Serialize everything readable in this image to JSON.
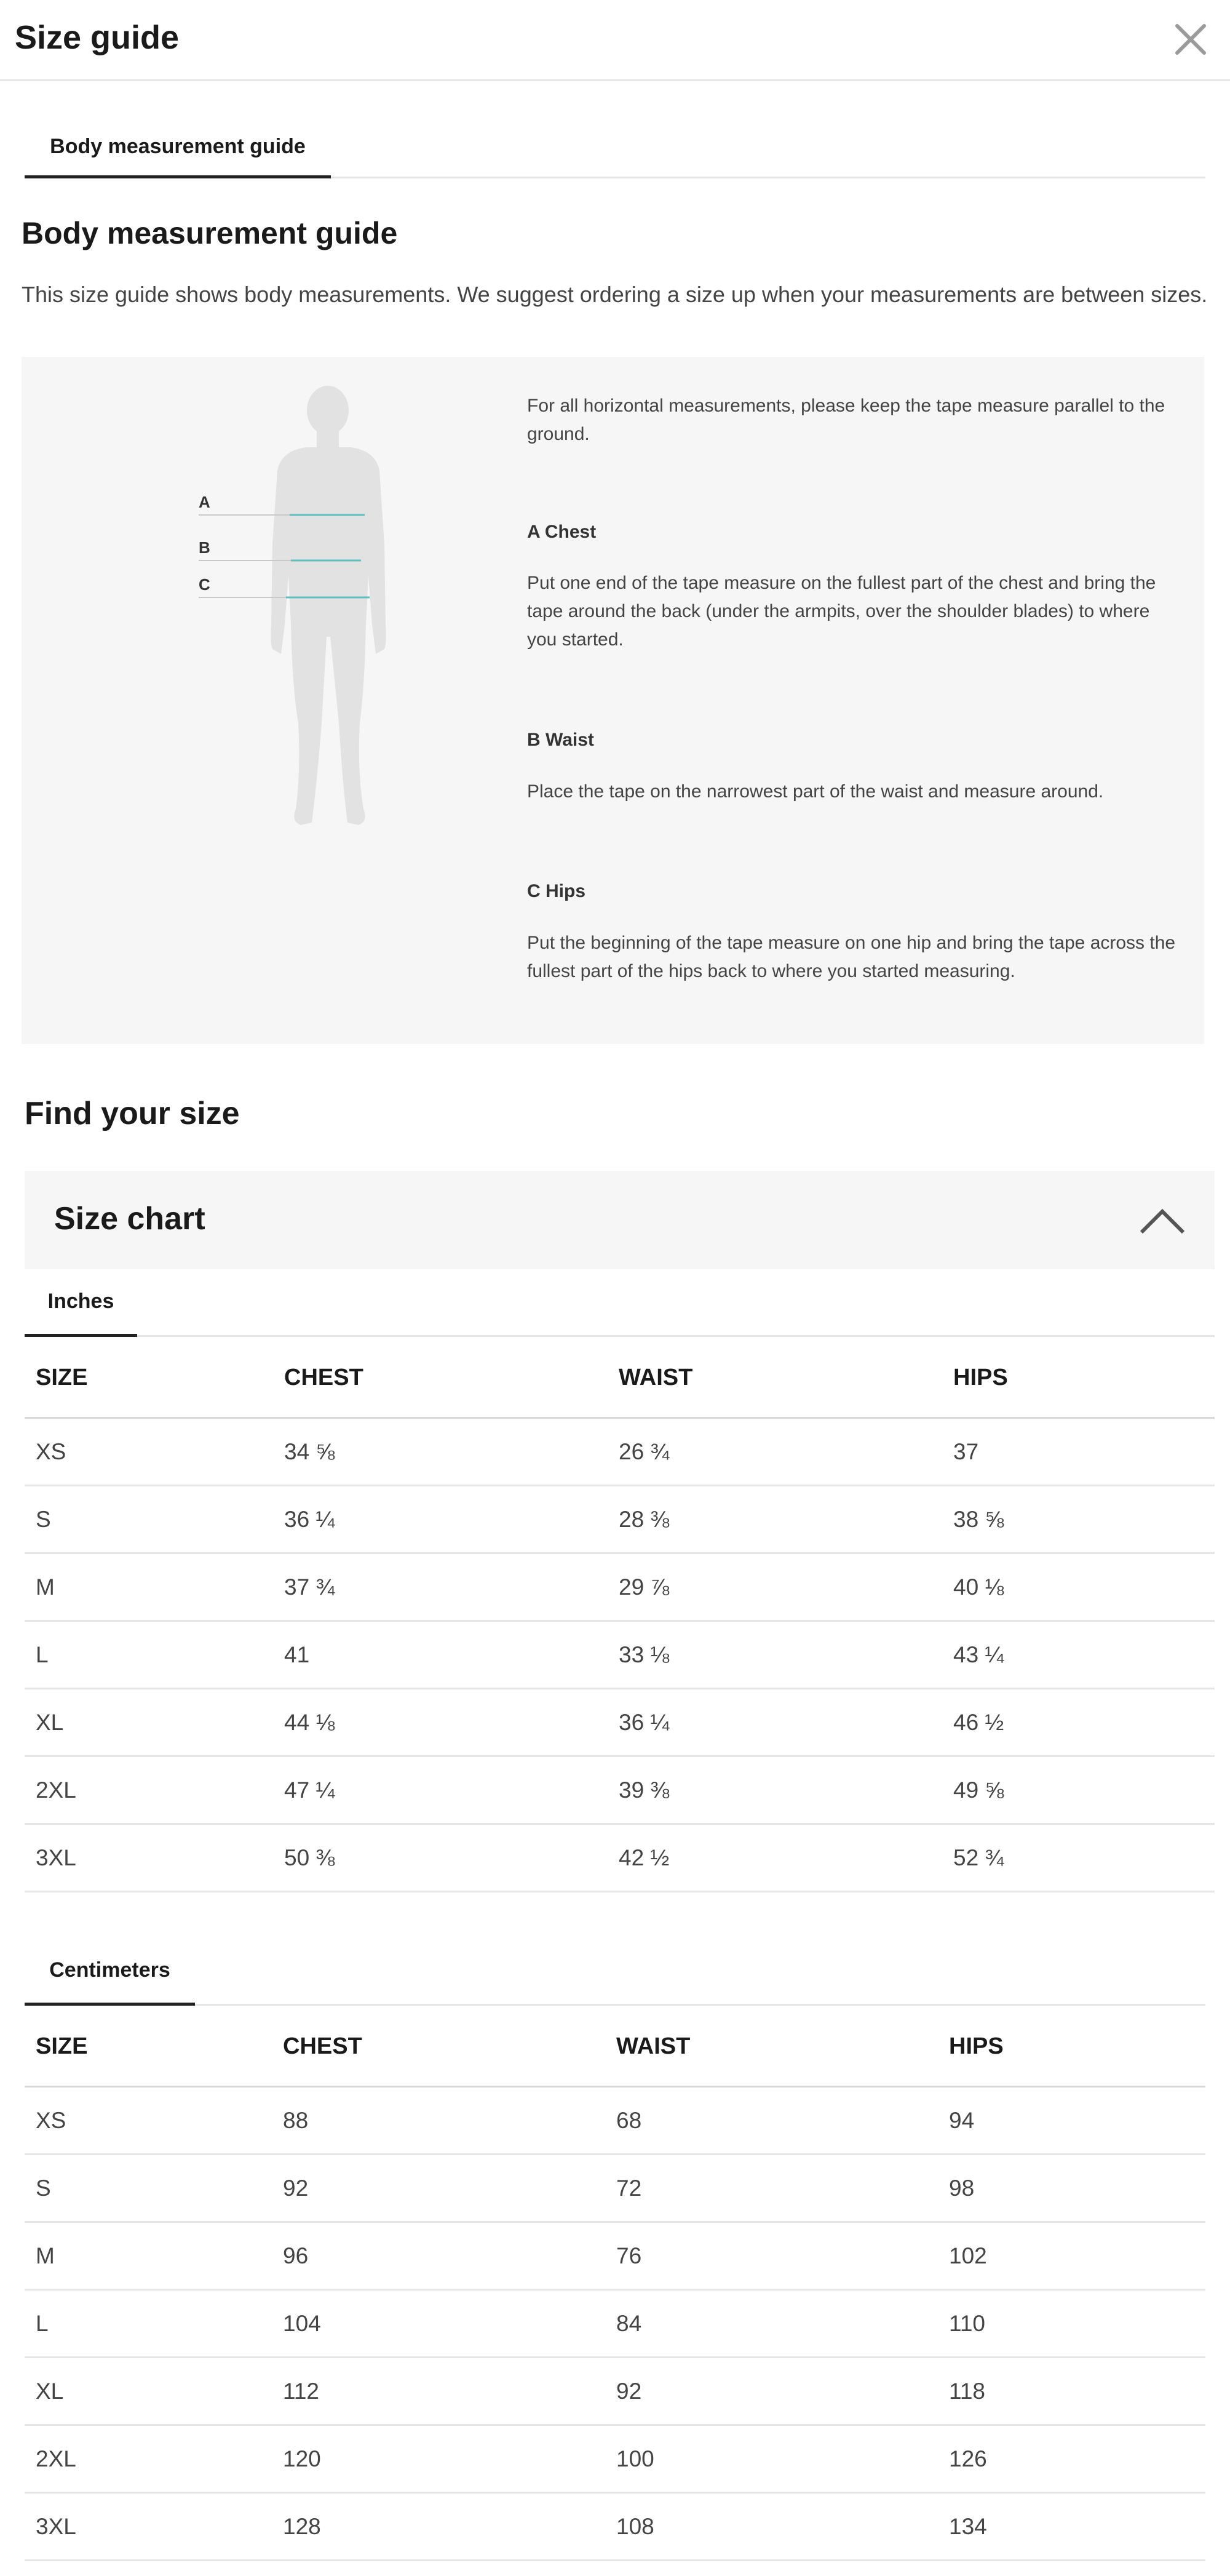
{
  "header": {
    "title": "Size guide"
  },
  "tabs": {
    "active_label": "Body measurement guide"
  },
  "guide": {
    "title": "Body measurement guide",
    "description": "This size guide shows body measurements. We suggest ordering a size up when your measurements are between sizes.",
    "figure_labels": [
      "A",
      "B",
      "C"
    ],
    "intro": "For all horizontal measurements, please keep the tape measure parallel to the ground.",
    "sections": [
      {
        "heading": "A Chest",
        "text": "Put one end of the tape measure on the fullest part of the chest and bring the tape around the back (under the armpits, over the shoulder blades) to where you started."
      },
      {
        "heading": "B Waist",
        "text": "Place the tape on the narrowest part of the waist and measure around."
      },
      {
        "heading": "C Hips",
        "text": "Put the beginning of the tape measure on one hip and bring the tape across the fullest part of the hips back to where you started measuring."
      }
    ]
  },
  "find": {
    "title": "Find your size"
  },
  "size_chart": {
    "label": "Size chart",
    "expanded": true,
    "inches": {
      "tab_label": "Inches",
      "columns": [
        "SIZE",
        "CHEST",
        "WAIST",
        "HIPS"
      ],
      "rows": [
        [
          "XS",
          "34 ⅝",
          "26 ¾",
          "37"
        ],
        [
          "S",
          "36 ¼",
          "28 ⅜",
          "38 ⅝"
        ],
        [
          "M",
          "37 ¾",
          "29 ⅞",
          "40 ⅛"
        ],
        [
          "L",
          "41",
          "33 ⅛",
          "43 ¼"
        ],
        [
          "XL",
          "44 ⅛",
          "36 ¼",
          "46 ½"
        ],
        [
          "2XL",
          "47 ¼",
          "39 ⅜",
          "49 ⅝"
        ],
        [
          "3XL",
          "50 ⅜",
          "42 ½",
          "52 ¾"
        ]
      ]
    },
    "centimeters": {
      "tab_label": "Centimeters",
      "columns": [
        "SIZE",
        "CHEST",
        "WAIST",
        "HIPS"
      ],
      "rows": [
        [
          "XS",
          "88",
          "68",
          "94"
        ],
        [
          "S",
          "92",
          "72",
          "98"
        ],
        [
          "M",
          "96",
          "76",
          "102"
        ],
        [
          "L",
          "104",
          "84",
          "110"
        ],
        [
          "XL",
          "112",
          "92",
          "118"
        ],
        [
          "2XL",
          "120",
          "100",
          "126"
        ],
        [
          "3XL",
          "128",
          "108",
          "134"
        ]
      ]
    }
  },
  "colors": {
    "measure_line": "#5bc0be",
    "figure_fill": "#e2e2e2",
    "panel_bg": "#f6f6f6",
    "active_tab_underline": "#222222"
  }
}
